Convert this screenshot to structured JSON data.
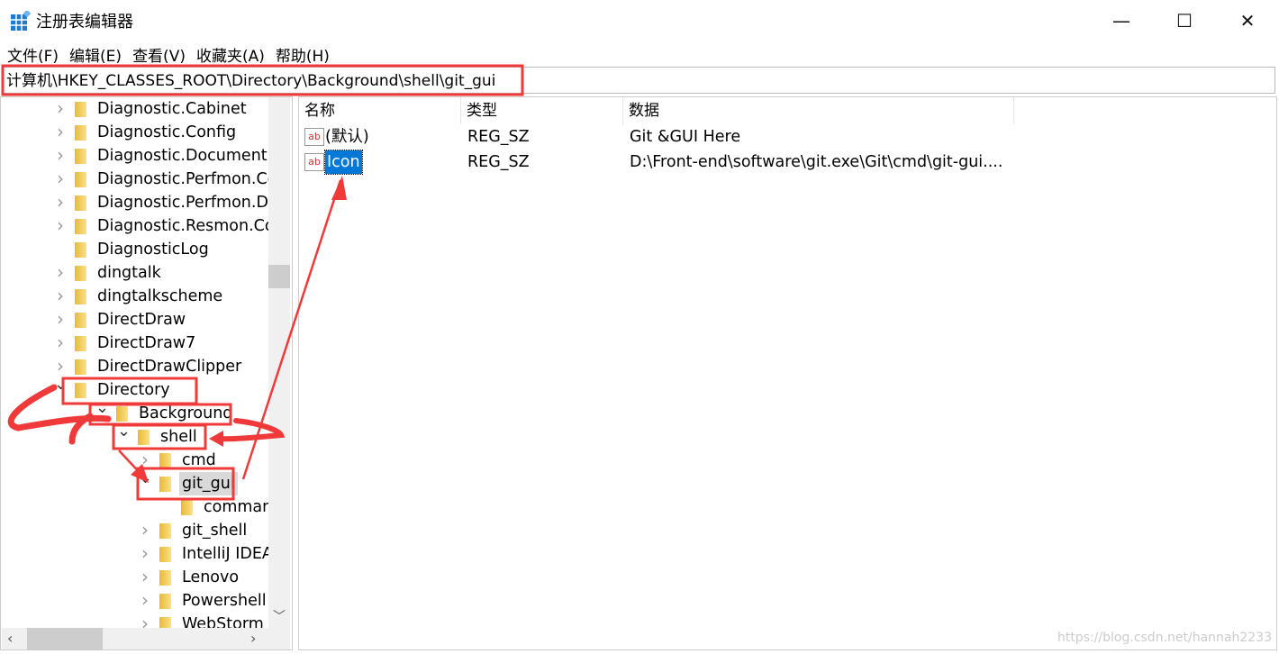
{
  "window": {
    "title": "注册表编辑器",
    "minimize": "—",
    "maximize": "☐",
    "close": "✕"
  },
  "menu": [
    "文件(F)",
    "编辑(E)",
    "查看(V)",
    "收藏夹(A)",
    "帮助(H)"
  ],
  "address": "计算机\\HKEY_CLASSES_ROOT\\Directory\\Background\\shell\\git_gui",
  "tree": [
    {
      "label": "Diagnostic.Cabinet",
      "level": 0,
      "state": "closed"
    },
    {
      "label": "Diagnostic.Config",
      "level": 0,
      "state": "closed"
    },
    {
      "label": "Diagnostic.Document",
      "level": 0,
      "state": "closed"
    },
    {
      "label": "Diagnostic.Perfmon.Co",
      "level": 0,
      "state": "closed"
    },
    {
      "label": "Diagnostic.Perfmon.Do",
      "level": 0,
      "state": "closed"
    },
    {
      "label": "Diagnostic.Resmon.Co",
      "level": 0,
      "state": "closed"
    },
    {
      "label": "DiagnosticLog",
      "level": 0,
      "state": "leaf"
    },
    {
      "label": "dingtalk",
      "level": 0,
      "state": "closed"
    },
    {
      "label": "dingtalkscheme",
      "level": 0,
      "state": "closed"
    },
    {
      "label": "DirectDraw",
      "level": 0,
      "state": "closed"
    },
    {
      "label": "DirectDraw7",
      "level": 0,
      "state": "closed"
    },
    {
      "label": "DirectDrawClipper",
      "level": 0,
      "state": "closed"
    },
    {
      "label": "Directory",
      "level": 0,
      "state": "open"
    },
    {
      "label": "Background",
      "level": 1,
      "state": "open"
    },
    {
      "label": "shell",
      "level": 2,
      "state": "open"
    },
    {
      "label": "cmd",
      "level": 3,
      "state": "closed"
    },
    {
      "label": "git_gui",
      "level": 3,
      "state": "open",
      "selected": true
    },
    {
      "label": "command",
      "level": 4,
      "state": "leaf"
    },
    {
      "label": "git_shell",
      "level": 3,
      "state": "closed"
    },
    {
      "label": "IntelliJ IDEA",
      "level": 3,
      "state": "closed"
    },
    {
      "label": "Lenovo",
      "level": 3,
      "state": "closed"
    },
    {
      "label": "Powershell",
      "level": 3,
      "state": "closed"
    },
    {
      "label": "WebStorm",
      "level": 3,
      "state": "closed"
    }
  ],
  "columns": [
    "名称",
    "类型",
    "数据"
  ],
  "values": [
    {
      "name": "(默认)",
      "type": "REG_SZ",
      "data": "Git &GUI Here"
    },
    {
      "name": "Icon",
      "type": "REG_SZ",
      "data": "D:\\Front-end\\software\\git.exe\\Git\\cmd\\git-gui....",
      "selected": true
    }
  ],
  "watermark": "https://blog.csdn.net/hannah2233",
  "colors": {
    "annotation": "#f03a3a",
    "selection": "#0078d7"
  }
}
